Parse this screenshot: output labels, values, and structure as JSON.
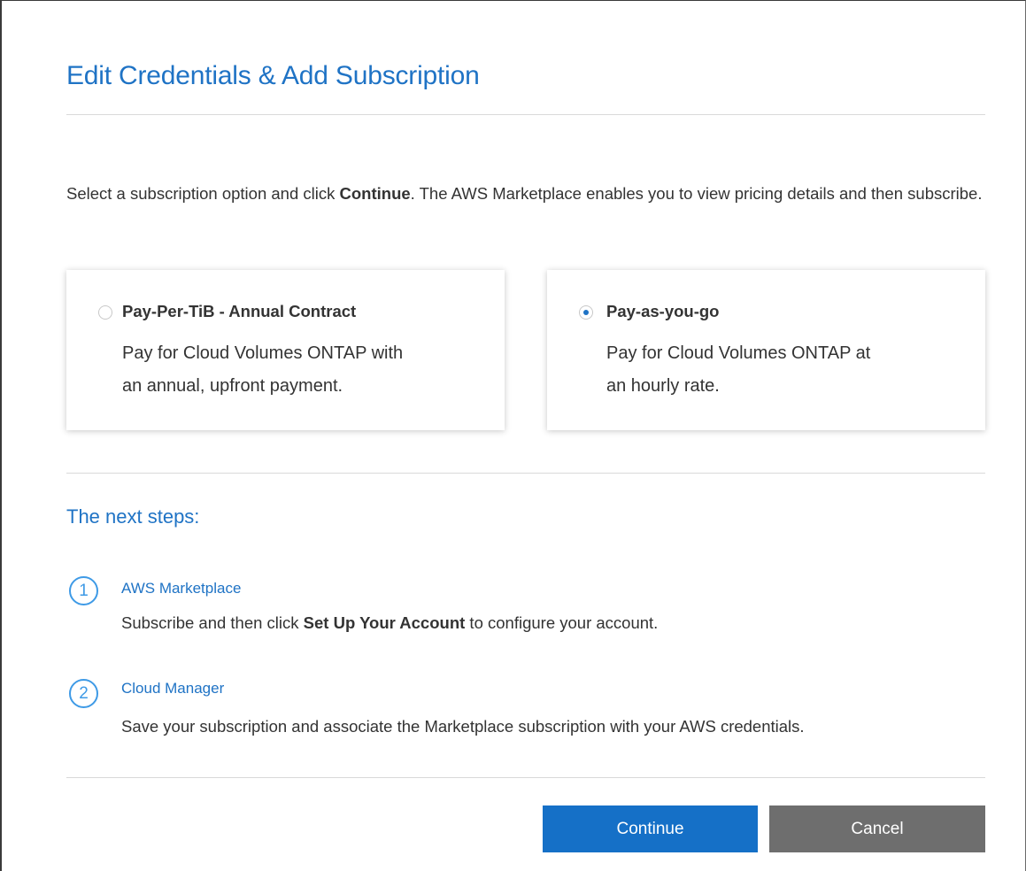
{
  "dialog": {
    "title": "Edit Credentials & Add Subscription"
  },
  "intro": {
    "prefix": "Select a subscription option and click ",
    "bold": "Continue",
    "suffix": ". The AWS Marketplace enables you to view pricing details and then subscribe."
  },
  "options": [
    {
      "title": "Pay-Per-TiB - Annual Contract",
      "desc_line1": "Pay for Cloud Volumes ONTAP with",
      "desc_line2": "an annual, upfront payment.",
      "selected": false
    },
    {
      "title": "Pay-as-you-go",
      "desc_line1": "Pay for Cloud Volumes ONTAP at",
      "desc_line2": "an hourly rate.",
      "selected": true
    }
  ],
  "next_steps": {
    "heading": "The next steps:",
    "steps": [
      {
        "number": "1",
        "title": "AWS Marketplace",
        "desc_prefix": "Subscribe and then click ",
        "desc_bold": "Set Up Your Account",
        "desc_suffix": " to configure your account."
      },
      {
        "number": "2",
        "title": "Cloud Manager",
        "desc": "Save your subscription and associate the Marketplace subscription with your AWS credentials."
      }
    ]
  },
  "buttons": {
    "continue": "Continue",
    "cancel": "Cancel"
  },
  "colors": {
    "accent": "#1f73c5",
    "primary_button": "#1570c7",
    "secondary_button": "#6e6e6e",
    "step_circle": "#3e9ae6"
  }
}
